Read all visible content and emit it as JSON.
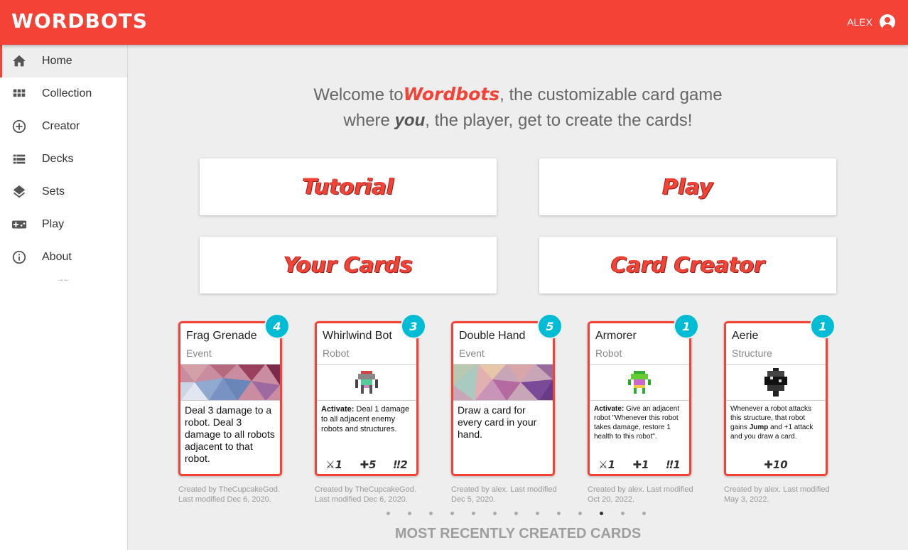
{
  "header": {
    "logo": "WORDBOTS",
    "username": "ALEX"
  },
  "sidebar": {
    "items": [
      {
        "label": "Home",
        "icon": "home-icon"
      },
      {
        "label": "Collection",
        "icon": "grid-icon"
      },
      {
        "label": "Creator",
        "icon": "add-circle-icon"
      },
      {
        "label": "Decks",
        "icon": "list-icon"
      },
      {
        "label": "Sets",
        "icon": "layers-icon"
      },
      {
        "label": "Play",
        "icon": "gamepad-icon"
      },
      {
        "label": "About",
        "icon": "info-icon"
      }
    ],
    "collapse_label": "→←"
  },
  "welcome": {
    "line1_pre": "Welcome to",
    "brand": "Wordbots",
    "line1_post": ", the customizable card game",
    "line2_pre": "where ",
    "line2_em": "you",
    "line2_post": ", the player, get to create the cards!"
  },
  "buttons": {
    "tutorial": "Tutorial",
    "play": "Play",
    "your_cards": "Your Cards",
    "card_creator": "Card Creator"
  },
  "cards": [
    {
      "name": "Frag Grenade",
      "type": "Event",
      "cost": "4",
      "text": "Deal 3 damage to a robot. Deal 3 damage to all robots adjacent to that robot.",
      "stats": [],
      "credit_line1": "Created by TheCupcakeGod.",
      "credit_line2": "Last modified Dec 6, 2020."
    },
    {
      "name": "Whirlwind Bot",
      "type": "Robot",
      "cost": "3",
      "text_bold": "Activate:",
      "text": " Deal 1 damage to all adjacent enemy robots and structures.",
      "stats": [
        "1",
        "5",
        "2"
      ],
      "credit_line1": "Created by TheCupcakeGod.",
      "credit_line2": "Last modified Dec 6, 2020."
    },
    {
      "name": "Double Hand",
      "type": "Event",
      "cost": "5",
      "text": "Draw a card for every card in your hand.",
      "stats": [],
      "credit_line1": "Created by alex. Last modified",
      "credit_line2": "Dec 5, 2020."
    },
    {
      "name": "Armorer",
      "type": "Robot",
      "cost": "1",
      "text_bold": "Activate:",
      "text": " Give an adjacent robot \"Whenever this robot takes damage, restore 1 health to this robot\".",
      "stats": [
        "1",
        "1",
        "1"
      ],
      "credit_line1": "Created by alex. Last modified",
      "credit_line2": "Oct 20, 2022."
    },
    {
      "name": "Aerie",
      "type": "Structure",
      "cost": "1",
      "text_pre": "Whenever a robot attacks this structure, that robot gains ",
      "text_bold": "Jump",
      "text": " and +1 attack and you draw a card.",
      "stats": [
        "10"
      ],
      "credit_line1": "Created by alex. Last modified",
      "credit_line2": "May 3, 2022."
    }
  ],
  "carousel": {
    "count": 13,
    "active_index": 10
  },
  "section_title": "MOST RECENTLY CREATED CARDS",
  "colors": {
    "primary": "#f44336",
    "accent": "#00bcd4",
    "background": "#eeeeee"
  }
}
